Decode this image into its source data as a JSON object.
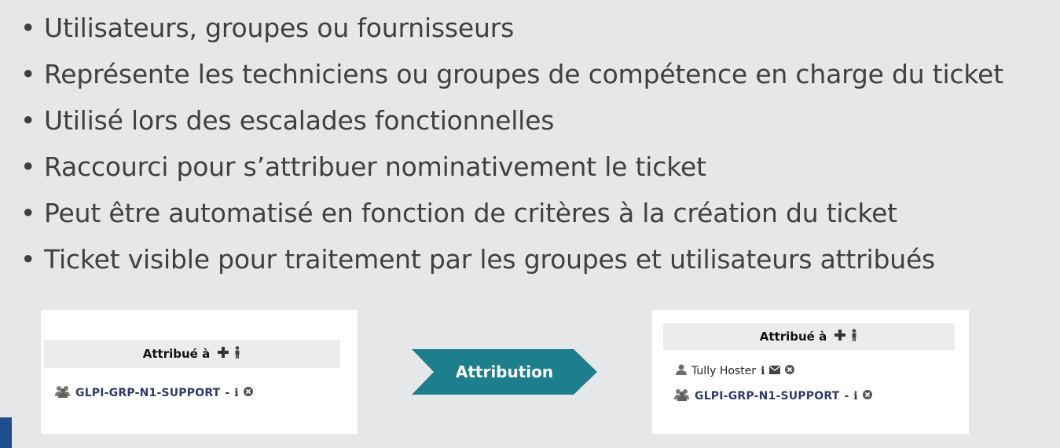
{
  "bullets": [
    "Utilisateurs, groupes ou fournisseurs",
    "Représente les techniciens ou groupes de compétence en charge du ticket",
    "Utilisé lors des escalades fonctionnelles",
    "Raccourci pour s’attribuer nominativement le ticket",
    "Peut être automatisé en fonction de critères à la création du ticket",
    "Ticket visible pour traitement par les groupes et utilisateurs attribués"
  ],
  "bullet_char": "•",
  "left_panel": {
    "header": "Attribué à",
    "group_name": "GLPI-GRP-N1-SUPPORT",
    "dash": "-"
  },
  "arrow": {
    "label": "Attribution",
    "color": "#1d7f8d"
  },
  "right_panel": {
    "header": "Attribué à",
    "user_name": "Tully Hoster",
    "group_name": "GLPI-GRP-N1-SUPPORT",
    "dash": "-"
  },
  "icons": {
    "plus": "plus-icon",
    "person": "person-icon",
    "group": "group-icon",
    "user": "user-icon",
    "info": "info-icon",
    "mail": "mail-icon",
    "remove": "remove-icon"
  },
  "colors": {
    "background": "#e6e7e8",
    "link": "#2d3b6b",
    "corner_bar": "#1f4e8c"
  }
}
